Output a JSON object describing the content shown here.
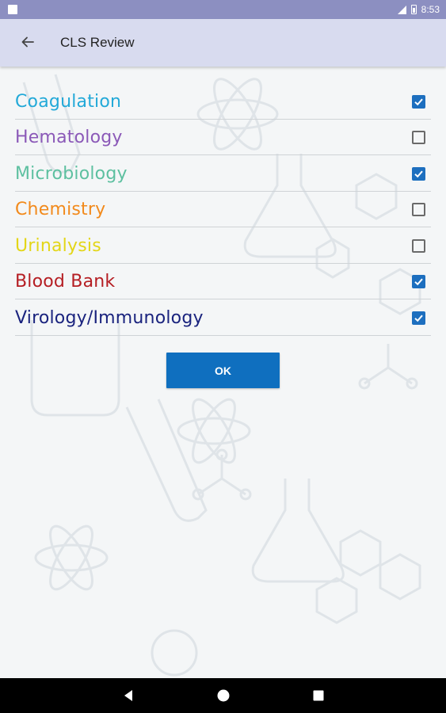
{
  "status_bar": {
    "time": "8:53",
    "icons": [
      "notification-icon",
      "signal-icon",
      "battery-icon"
    ]
  },
  "app_bar": {
    "title": "CLS Review",
    "back_icon": "arrow-left-icon"
  },
  "categories": [
    {
      "label": "Coagulation",
      "color": "#22a9d8",
      "checked": true
    },
    {
      "label": "Hematology",
      "color": "#8b59b8",
      "checked": false
    },
    {
      "label": "Microbiology",
      "color": "#5dc0a0",
      "checked": true
    },
    {
      "label": "Chemistry",
      "color": "#f28a1c",
      "checked": false
    },
    {
      "label": "Urinalysis",
      "color": "#e3d618",
      "checked": false
    },
    {
      "label": "Blood Bank",
      "color": "#b51e23",
      "checked": true
    },
    {
      "label": "Virology/Immunology",
      "color": "#1a237e",
      "checked": true
    }
  ],
  "ok_button": {
    "label": "OK",
    "color": "#0f6fbf"
  },
  "checkbox_color": "#1d6fbf",
  "nav_bar": {
    "icons": [
      "back-triangle-icon",
      "home-circle-icon",
      "recents-square-icon"
    ]
  }
}
